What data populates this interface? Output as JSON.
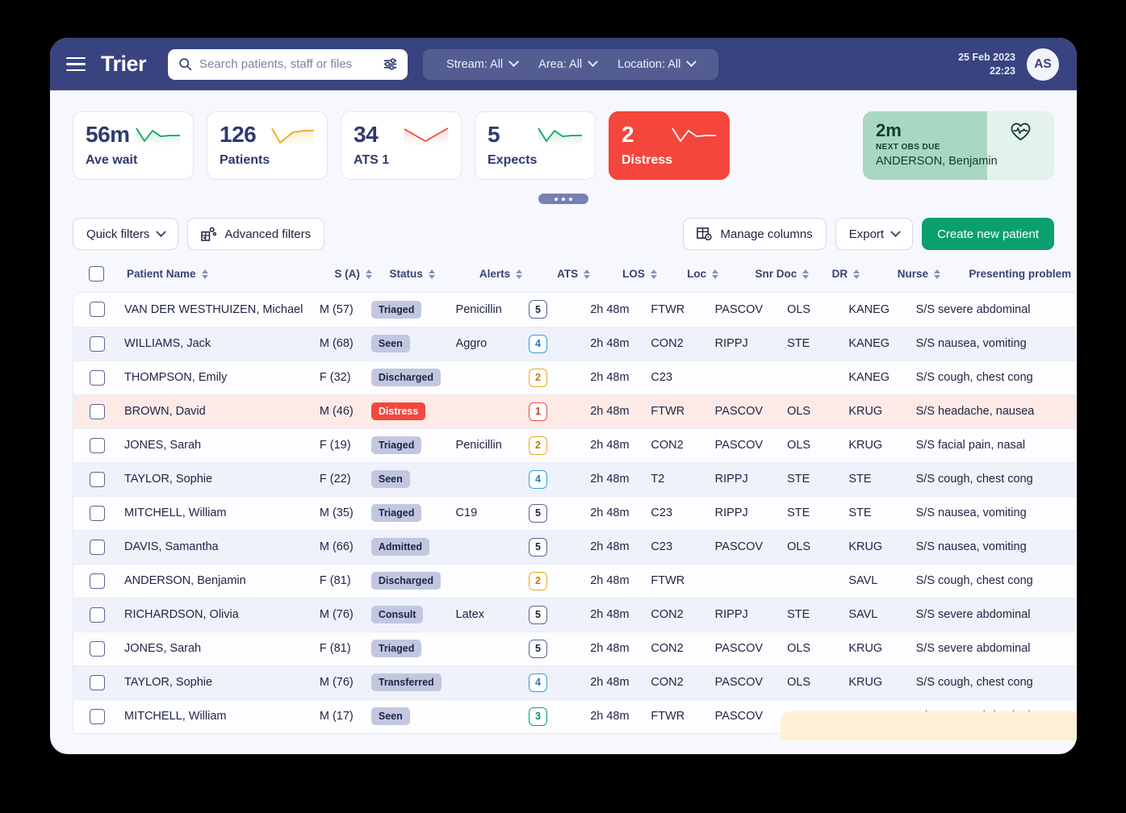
{
  "topbar": {
    "menu_icon": "hamburger-icon",
    "brand": "Trier",
    "search": {
      "icon": "search-icon",
      "placeholder": "Search patients, staff or files",
      "filter_icon": "sliders-icon",
      "value": ""
    },
    "filters": [
      {
        "label": "Stream: All",
        "icon": "chevron-down-icon"
      },
      {
        "label": "Area: All",
        "icon": "chevron-down-icon"
      },
      {
        "label": "Location: All",
        "icon": "chevron-down-icon"
      }
    ],
    "date": "25 Feb 2023",
    "time": "22:23",
    "avatar_initials": "AS",
    "bg_color": "#394380"
  },
  "kpis": [
    {
      "value": "56m",
      "label": "Ave wait",
      "trend_color": "#12a463",
      "alarm": false
    },
    {
      "value": "126",
      "label": "Patients",
      "trend_color": "#f0a81e",
      "alarm": false
    },
    {
      "value": "34",
      "label": "ATS 1",
      "trend_color": "#f4463c",
      "alarm": false
    },
    {
      "value": "5",
      "label": "Expects",
      "trend_color": "#12a463",
      "alarm": false
    },
    {
      "value": "2",
      "label": "Distress",
      "trend_color": "#ffffff",
      "alarm": true
    }
  ],
  "next_obs": {
    "value": "2m",
    "caption": "NEXT OBS DUE",
    "patient": "ANDERSON, Benjamin",
    "icon": "heart-pulse-icon",
    "bg_color": "#a8d8c2"
  },
  "drag_handle": {
    "icon": "drag-dots-icon"
  },
  "toolbar": {
    "quick_filters": "Quick filters",
    "advanced_filters": "Advanced filters",
    "advanced_filters_icon": "filter-grid-icon",
    "manage_columns": "Manage columns",
    "manage_columns_icon": "columns-settings-icon",
    "export": "Export",
    "create_patient": "Create new patient",
    "primary_color": "#0aa06e"
  },
  "table": {
    "select_all_checkbox": "select-all",
    "columns": [
      {
        "label": "Patient Name",
        "sortable": true
      },
      {
        "label": "S (A)",
        "sortable": true
      },
      {
        "label": "Status",
        "sortable": true
      },
      {
        "label": "Alerts",
        "sortable": true
      },
      {
        "label": "ATS",
        "sortable": true
      },
      {
        "label": "LOS",
        "sortable": true
      },
      {
        "label": "Loc",
        "sortable": true
      },
      {
        "label": "Snr Doc",
        "sortable": true
      },
      {
        "label": "DR",
        "sortable": true
      },
      {
        "label": "Nurse",
        "sortable": true
      },
      {
        "label": "Presenting problem",
        "sortable": false
      }
    ],
    "rows": [
      {
        "name": "VAN DER WESTHUIZEN, Michael",
        "sa": "M (57)",
        "status": "Triaged",
        "alerts": "Penicillin",
        "ats": "5",
        "los": "2h 48m",
        "loc": "FTWR",
        "snr": "PASCOV",
        "dr": "OLS",
        "nurse": "KANEG",
        "problem": "S/S severe abdominal",
        "highlight": "none"
      },
      {
        "name": "WILLIAMS, Jack",
        "sa": "M (68)",
        "status": "Seen",
        "alerts": "Aggro",
        "ats": "4",
        "los": "2h 48m",
        "loc": "CON2",
        "snr": "RIPPJ",
        "dr": "STE",
        "nurse": "KANEG",
        "problem": "S/S nausea, vomiting",
        "highlight": "alt"
      },
      {
        "name": "THOMPSON, Emily",
        "sa": "F (32)",
        "status": "Discharged",
        "alerts": "",
        "ats": "2",
        "los": "2h 48m",
        "loc": "C23",
        "snr": "",
        "dr": "",
        "nurse": "KANEG",
        "problem": "S/S cough, chest cong",
        "highlight": "none"
      },
      {
        "name": "BROWN, David",
        "sa": "M (46)",
        "status": "Distress",
        "alerts": "",
        "ats": "1",
        "los": "2h 48m",
        "loc": "FTWR",
        "snr": "PASCOV",
        "dr": "OLS",
        "nurse": "KRUG",
        "problem": "S/S headache, nausea",
        "highlight": "danger"
      },
      {
        "name": "JONES, Sarah",
        "sa": "F (19)",
        "status": "Triaged",
        "alerts": "Penicillin",
        "ats": "2",
        "los": "2h 48m",
        "loc": "CON2",
        "snr": "PASCOV",
        "dr": "OLS",
        "nurse": "KRUG",
        "problem": "S/S facial pain, nasal",
        "highlight": "none"
      },
      {
        "name": "TAYLOR, Sophie",
        "sa": "F (22)",
        "status": "Seen",
        "alerts": "",
        "ats": "4",
        "los": "2h 48m",
        "loc": "T2",
        "snr": "RIPPJ",
        "dr": "STE",
        "nurse": "STE",
        "problem": "S/S cough, chest cong",
        "highlight": "alt"
      },
      {
        "name": "MITCHELL, William",
        "sa": "M (35)",
        "status": "Triaged",
        "alerts": "C19",
        "ats": "5",
        "los": "2h 48m",
        "loc": "C23",
        "snr": "RIPPJ",
        "dr": "STE",
        "nurse": "STE",
        "problem": "S/S nausea, vomiting",
        "highlight": "none"
      },
      {
        "name": "DAVIS, Samantha",
        "sa": "M (66)",
        "status": "Admitted",
        "alerts": "",
        "ats": "5",
        "los": "2h 48m",
        "loc": "C23",
        "snr": "PASCOV",
        "dr": "OLS",
        "nurse": "KRUG",
        "problem": "S/S nausea, vomiting",
        "highlight": "alt"
      },
      {
        "name": "ANDERSON, Benjamin",
        "sa": "F (81)",
        "status": "Discharged",
        "alerts": "",
        "ats": "2",
        "los": "2h 48m",
        "loc": "FTWR",
        "snr": "",
        "dr": "",
        "nurse": "SAVL",
        "problem": "S/S cough, chest cong",
        "highlight": "none"
      },
      {
        "name": "RICHARDSON, Olivia",
        "sa": "M (76)",
        "status": "Consult",
        "alerts": "Latex",
        "ats": "5",
        "los": "2h 48m",
        "loc": "CON2",
        "snr": "RIPPJ",
        "dr": "STE",
        "nurse": "SAVL",
        "problem": "S/S severe abdominal",
        "highlight": "alt"
      },
      {
        "name": "JONES, Sarah",
        "sa": "F (81)",
        "status": "Triaged",
        "alerts": "",
        "ats": "5",
        "los": "2h 48m",
        "loc": "CON2",
        "snr": "PASCOV",
        "dr": "OLS",
        "nurse": "KRUG",
        "problem": "S/S severe abdominal",
        "highlight": "none"
      },
      {
        "name": "TAYLOR, Sophie",
        "sa": "M (76)",
        "status": "Transferred",
        "alerts": "",
        "ats": "4",
        "los": "2h 48m",
        "loc": "CON2",
        "snr": "PASCOV",
        "dr": "OLS",
        "nurse": "KRUG",
        "problem": "S/S cough, chest cong",
        "highlight": "alt"
      },
      {
        "name": "MITCHELL, William",
        "sa": "M (17)",
        "status": "Seen",
        "alerts": "",
        "ats": "3",
        "los": "2h 48m",
        "loc": "FTWR",
        "snr": "PASCOV",
        "dr": "STE",
        "nurse": "KRUG",
        "problem": "S/S severe abdominal",
        "highlight": "none"
      }
    ]
  }
}
